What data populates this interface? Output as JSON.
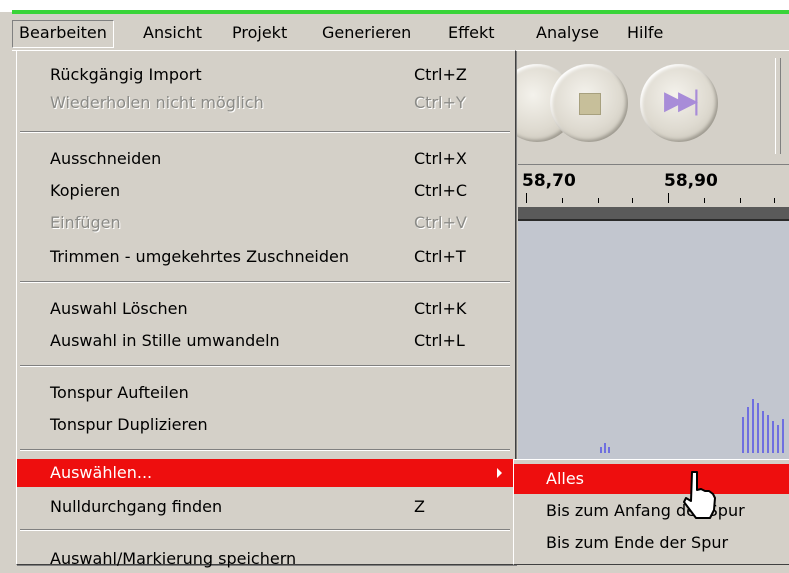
{
  "menubar": {
    "items": [
      "Bearbeiten",
      "Ansicht",
      "Projekt",
      "Generieren",
      "Effekt",
      "Analyse",
      "Hilfe"
    ]
  },
  "edit_menu": {
    "items": [
      {
        "label": "Rückgängig Import",
        "shortcut": "Ctrl+Z",
        "enabled": true
      },
      {
        "label": "Wiederholen nicht möglich",
        "shortcut": "Ctrl+Y",
        "enabled": false
      },
      {
        "label": "Ausschneiden",
        "shortcut": "Ctrl+X",
        "enabled": true
      },
      {
        "label": "Kopieren",
        "shortcut": "Ctrl+C",
        "enabled": true
      },
      {
        "label": "Einfügen",
        "shortcut": "Ctrl+V",
        "enabled": false
      },
      {
        "label": "Trimmen - umgekehrtes Zuschneiden",
        "shortcut": "Ctrl+T",
        "enabled": true
      },
      {
        "label": "Auswahl Löschen",
        "shortcut": "Ctrl+K",
        "enabled": true
      },
      {
        "label": "Auswahl in Stille umwandeln",
        "shortcut": "Ctrl+L",
        "enabled": true
      },
      {
        "label": "Tonspur Aufteilen",
        "shortcut": "",
        "enabled": true
      },
      {
        "label": "Tonspur Duplizieren",
        "shortcut": "",
        "enabled": true
      },
      {
        "label": "Auswählen...",
        "shortcut": "",
        "enabled": true,
        "highlighted": true,
        "has_submenu": true
      },
      {
        "label": "Nulldurchgang finden",
        "shortcut": "Z",
        "enabled": true
      },
      {
        "label": "Auswahl/Markierung speichern",
        "shortcut": "",
        "enabled": true
      }
    ]
  },
  "select_submenu": {
    "items": [
      "Alles",
      "Bis zum Anfang der Spur",
      "Bis zum Ende der Spur"
    ]
  },
  "ruler": {
    "labels": [
      "58,70",
      "58,90"
    ]
  },
  "toolbar": {
    "buttons": [
      "stop-icon",
      "skip-to-end-icon"
    ]
  },
  "colors": {
    "highlight": "#ee0e0e",
    "menu_bg": "#d4d0c8",
    "accent_green": "#39d439",
    "waveform": "#6f6fe0"
  }
}
